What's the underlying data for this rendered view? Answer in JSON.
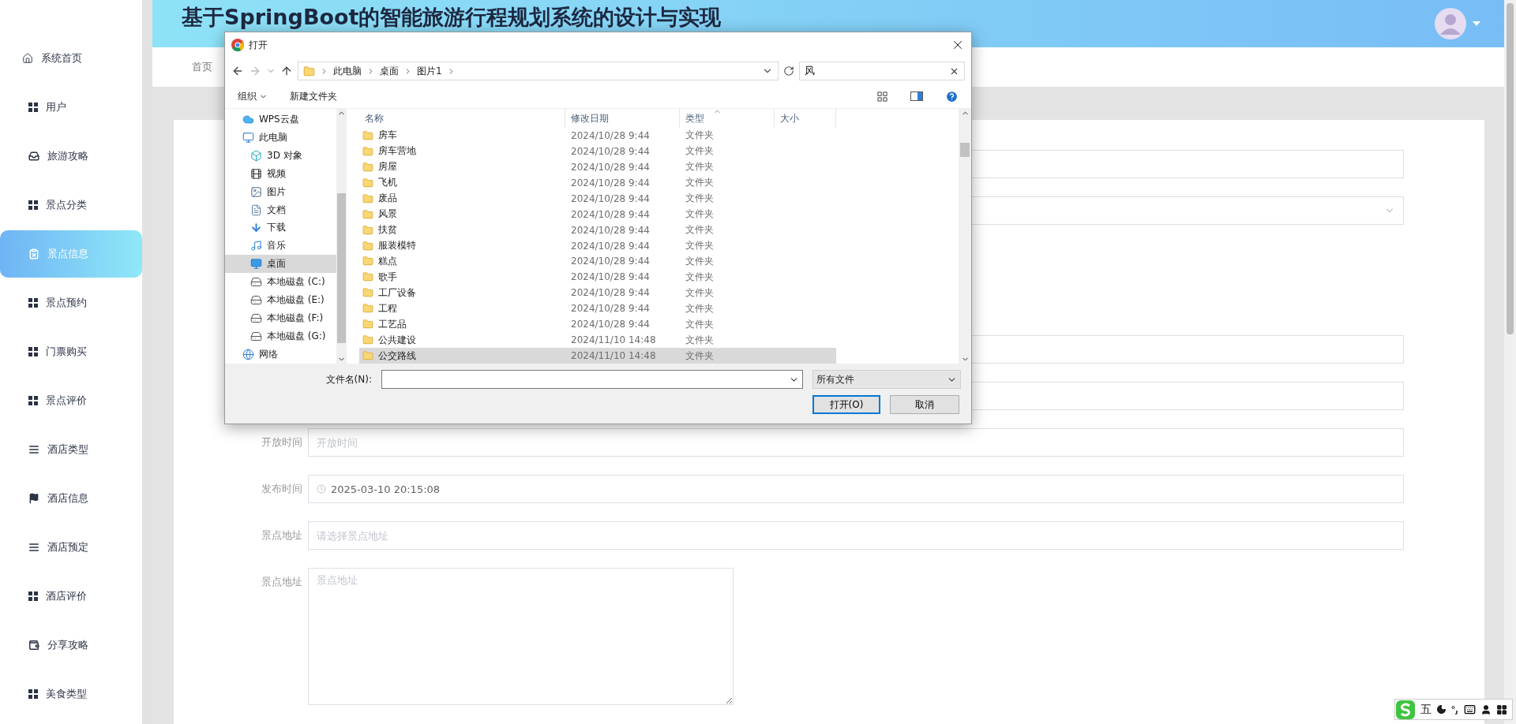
{
  "sidebar": {
    "items": [
      {
        "label": "系统首页",
        "kind": "home",
        "selected": false
      },
      {
        "label": "用户",
        "kind": "grid",
        "selected": false
      },
      {
        "label": "旅游攻略",
        "kind": "tray",
        "selected": false
      },
      {
        "label": "景点分类",
        "kind": "grid",
        "selected": false
      },
      {
        "label": "景点信息",
        "kind": "clipboard",
        "selected": true
      },
      {
        "label": "景点预约",
        "kind": "grid",
        "selected": false
      },
      {
        "label": "门票购买",
        "kind": "grid",
        "selected": false
      },
      {
        "label": "景点评价",
        "kind": "grid",
        "selected": false
      },
      {
        "label": "酒店类型",
        "kind": "list",
        "selected": false
      },
      {
        "label": "酒店信息",
        "kind": "flag",
        "selected": false
      },
      {
        "label": "酒店预定",
        "kind": "list",
        "selected": false
      },
      {
        "label": "酒店评价",
        "kind": "grid",
        "selected": false
      },
      {
        "label": "分享攻略",
        "kind": "wallet",
        "selected": false
      },
      {
        "label": "美食类型",
        "kind": "grid",
        "selected": false
      }
    ]
  },
  "header": {
    "title": "基于SpringBoot的智能旅游行程规划系统的设计与实现"
  },
  "tabs": [
    {
      "label": "首页"
    }
  ],
  "form": {
    "fields": [
      {
        "kind": "input"
      },
      {
        "kind": "select"
      },
      {
        "kind": "input"
      },
      {
        "kind": "input"
      },
      {
        "kind": "input",
        "label": "开放时间",
        "placeholder": "开放时间"
      },
      {
        "kind": "date",
        "label": "发布时间",
        "value": "2025-03-10 20:15:08"
      },
      {
        "kind": "input",
        "label": "景点地址",
        "placeholder": "请选择景点地址"
      },
      {
        "kind": "textarea",
        "label": "景点地址",
        "placeholder": "景点地址"
      }
    ]
  },
  "dialog": {
    "title": "打开",
    "path": [
      "此电脑",
      "桌面",
      "图片1"
    ],
    "search": "风",
    "toolbar": [
      "组织",
      "新建文件夹"
    ],
    "nav": [
      {
        "label": "WPS云盘",
        "kind": "cloud",
        "selected": false
      },
      {
        "label": "此电脑",
        "kind": "computer",
        "selected": false,
        "children": [
          {
            "label": "3D 对象",
            "kind": "cube",
            "selected": false
          },
          {
            "label": "视频",
            "kind": "video",
            "selected": false
          },
          {
            "label": "图片",
            "kind": "image",
            "selected": false
          },
          {
            "label": "文档",
            "kind": "document",
            "selected": false
          },
          {
            "label": "下载",
            "kind": "download",
            "selected": false
          },
          {
            "label": "音乐",
            "kind": "music",
            "selected": false
          },
          {
            "label": "桌面",
            "kind": "desktop",
            "selected": true
          },
          {
            "label": "本地磁盘 (C:)",
            "kind": "drive",
            "selected": false
          },
          {
            "label": "本地磁盘 (E:)",
            "kind": "drive",
            "selected": false
          },
          {
            "label": "本地磁盘 (F:)",
            "kind": "drive",
            "selected": false
          },
          {
            "label": "本地磁盘 (G:)",
            "kind": "drive",
            "selected": false
          }
        ]
      },
      {
        "label": "网络",
        "kind": "network",
        "selected": false
      }
    ],
    "columns": [
      "名称",
      "修改日期",
      "类型",
      "大小"
    ],
    "files": [
      {
        "name": "房车",
        "modified": "2024/10/28 9:44",
        "type": "文件夹",
        "selected": false
      },
      {
        "name": "房车营地",
        "modified": "2024/10/28 9:44",
        "type": "文件夹",
        "selected": false
      },
      {
        "name": "房屋",
        "modified": "2024/10/28 9:44",
        "type": "文件夹",
        "selected": false
      },
      {
        "name": "飞机",
        "modified": "2024/10/28 9:44",
        "type": "文件夹",
        "selected": false
      },
      {
        "name": "废品",
        "modified": "2024/10/28 9:44",
        "type": "文件夹",
        "selected": false
      },
      {
        "name": "风景",
        "modified": "2024/10/28 9:44",
        "type": "文件夹",
        "selected": false
      },
      {
        "name": "扶贫",
        "modified": "2024/10/28 9:44",
        "type": "文件夹",
        "selected": false
      },
      {
        "name": "服装模特",
        "modified": "2024/10/28 9:44",
        "type": "文件夹",
        "selected": false
      },
      {
        "name": "糕点",
        "modified": "2024/10/28 9:44",
        "type": "文件夹",
        "selected": false
      },
      {
        "name": "歌手",
        "modified": "2024/10/28 9:44",
        "type": "文件夹",
        "selected": false
      },
      {
        "name": "工厂设备",
        "modified": "2024/10/28 9:44",
        "type": "文件夹",
        "selected": false
      },
      {
        "name": "工程",
        "modified": "2024/10/28 9:44",
        "type": "文件夹",
        "selected": false
      },
      {
        "name": "工艺品",
        "modified": "2024/10/28 9:44",
        "type": "文件夹",
        "selected": false
      },
      {
        "name": "公共建设",
        "modified": "2024/11/10 14:48",
        "type": "文件夹",
        "selected": false
      },
      {
        "name": "公交路线",
        "modified": "2024/11/10 14:48",
        "type": "文件夹",
        "selected": true
      }
    ],
    "filename_label": "文件名(N):",
    "filetype": "所有文件",
    "buttons": [
      "打开(O)",
      "取消"
    ]
  },
  "ime": {
    "mode": "五"
  }
}
